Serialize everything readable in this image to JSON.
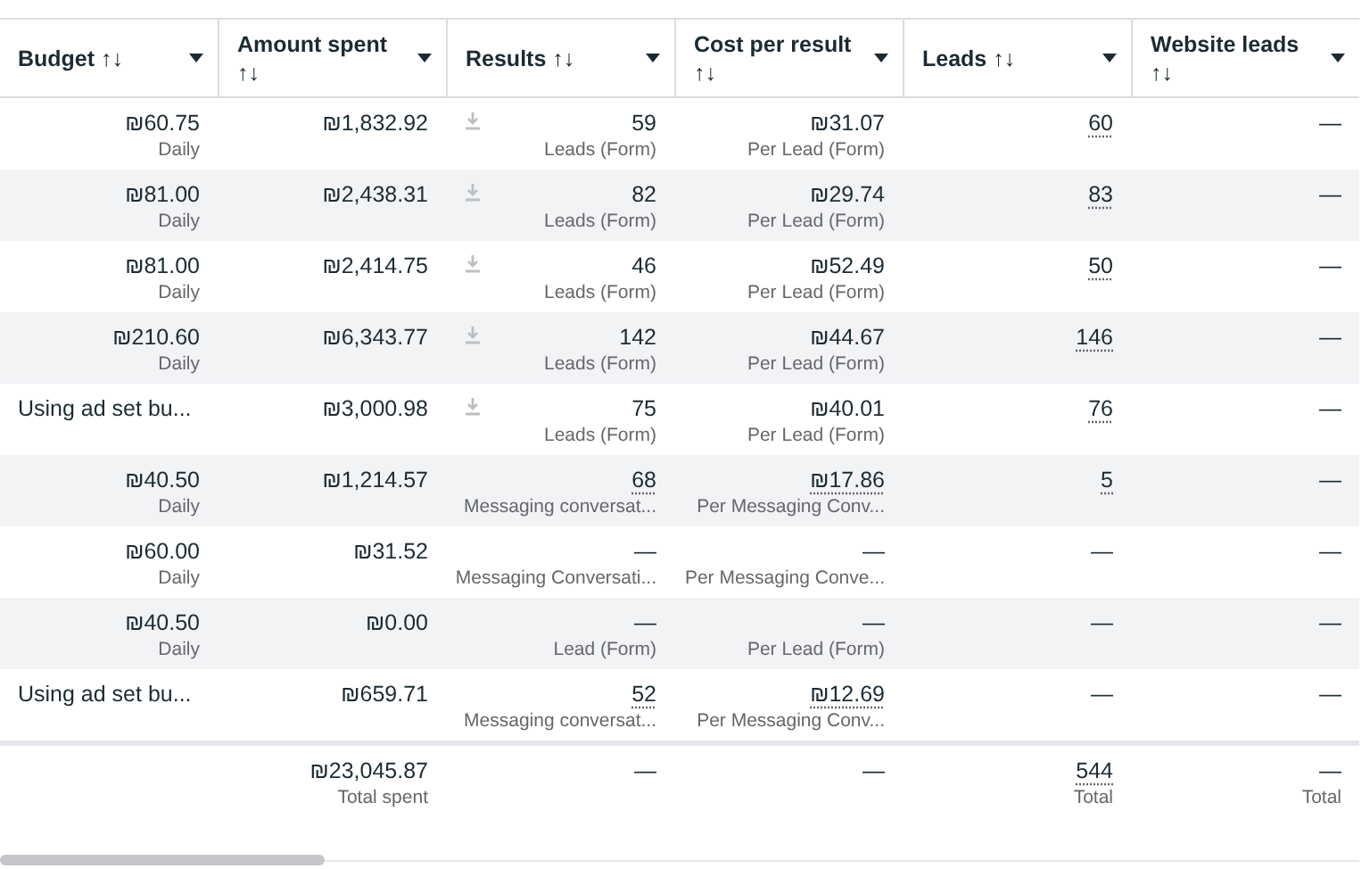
{
  "columns": [
    {
      "label": "Budget ↑↓"
    },
    {
      "label": "Amount spent ↑↓"
    },
    {
      "label": "Results ↑↓"
    },
    {
      "label": "Cost per result ↑↓"
    },
    {
      "label": "Leads ↑↓"
    },
    {
      "label": "Website leads ↑↓"
    }
  ],
  "rows": [
    {
      "budget": {
        "value": "₪60.75",
        "sub": "Daily"
      },
      "spent": "₪1,832.92",
      "download": true,
      "results": {
        "value": "59",
        "underlined": false,
        "sub": "Leads (Form)"
      },
      "cost": {
        "value": "₪31.07",
        "underlined": false,
        "sub": "Per Lead (Form)"
      },
      "leads": {
        "value": "60",
        "underlined": true
      },
      "website_leads": "—"
    },
    {
      "budget": {
        "value": "₪81.00",
        "sub": "Daily"
      },
      "spent": "₪2,438.31",
      "download": true,
      "results": {
        "value": "82",
        "underlined": false,
        "sub": "Leads (Form)"
      },
      "cost": {
        "value": "₪29.74",
        "underlined": false,
        "sub": "Per Lead (Form)"
      },
      "leads": {
        "value": "83",
        "underlined": true
      },
      "website_leads": "—"
    },
    {
      "budget": {
        "value": "₪81.00",
        "sub": "Daily"
      },
      "spent": "₪2,414.75",
      "download": true,
      "results": {
        "value": "46",
        "underlined": false,
        "sub": "Leads (Form)"
      },
      "cost": {
        "value": "₪52.49",
        "underlined": false,
        "sub": "Per Lead (Form)"
      },
      "leads": {
        "value": "50",
        "underlined": true
      },
      "website_leads": "—"
    },
    {
      "budget": {
        "value": "₪210.60",
        "sub": "Daily"
      },
      "spent": "₪6,343.77",
      "download": true,
      "results": {
        "value": "142",
        "underlined": false,
        "sub": "Leads (Form)"
      },
      "cost": {
        "value": "₪44.67",
        "underlined": false,
        "sub": "Per Lead (Form)"
      },
      "leads": {
        "value": "146",
        "underlined": true
      },
      "website_leads": "—"
    },
    {
      "budget": {
        "value": "Using ad set bu..."
      },
      "spent": "₪3,000.98",
      "download": true,
      "results": {
        "value": "75",
        "underlined": false,
        "sub": "Leads (Form)"
      },
      "cost": {
        "value": "₪40.01",
        "underlined": false,
        "sub": "Per Lead (Form)"
      },
      "leads": {
        "value": "76",
        "underlined": true
      },
      "website_leads": "—"
    },
    {
      "budget": {
        "value": "₪40.50",
        "sub": "Daily"
      },
      "spent": "₪1,214.57",
      "download": false,
      "results": {
        "value": "68",
        "underlined": true,
        "sub": "Messaging conversat..."
      },
      "cost": {
        "value": "₪17.86",
        "underlined": true,
        "sub": "Per Messaging Conv..."
      },
      "leads": {
        "value": "5",
        "underlined": true
      },
      "website_leads": "—"
    },
    {
      "budget": {
        "value": "₪60.00",
        "sub": "Daily"
      },
      "spent": "₪31.52",
      "download": false,
      "results": {
        "value": "—",
        "underlined": false,
        "sub": "Messaging Conversati..."
      },
      "cost": {
        "value": "—",
        "underlined": false,
        "sub": "Per Messaging Conve..."
      },
      "leads": {
        "value": "—",
        "underlined": false
      },
      "website_leads": "—"
    },
    {
      "budget": {
        "value": "₪40.50",
        "sub": "Daily"
      },
      "spent": "₪0.00",
      "download": false,
      "results": {
        "value": "—",
        "underlined": false,
        "sub": "Lead (Form)"
      },
      "cost": {
        "value": "—",
        "underlined": false,
        "sub": "Per Lead (Form)"
      },
      "leads": {
        "value": "—",
        "underlined": false
      },
      "website_leads": "—"
    },
    {
      "budget": {
        "value": "Using ad set bu..."
      },
      "spent": "₪659.71",
      "download": false,
      "results": {
        "value": "52",
        "underlined": true,
        "sub": "Messaging conversat..."
      },
      "cost": {
        "value": "₪12.69",
        "underlined": true,
        "sub": "Per Messaging Conv..."
      },
      "leads": {
        "value": "—",
        "underlined": false
      },
      "website_leads": "—"
    }
  ],
  "totals": {
    "spent": {
      "value": "₪23,045.87",
      "sub": "Total spent"
    },
    "results": {
      "value": "—"
    },
    "cost": {
      "value": "—"
    },
    "leads": {
      "value": "544",
      "underlined": true,
      "sub": "Total"
    },
    "website_leads": {
      "value": "—",
      "sub": "Total"
    }
  }
}
